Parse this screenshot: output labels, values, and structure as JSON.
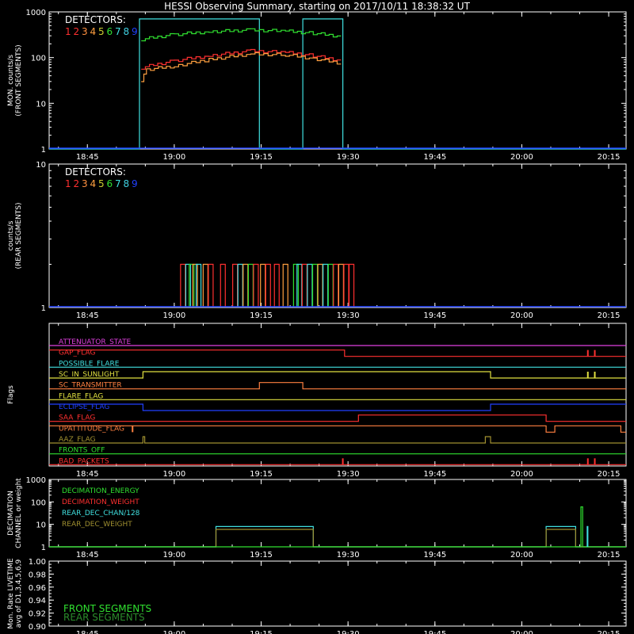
{
  "title": "HESSI Observing Summary, starting on 2017/10/11 18:38:32 UT",
  "colors": {
    "background": "#000000",
    "axis": "#ffffff",
    "det": [
      "#ff3030",
      "#ff3030",
      "#ff9040",
      "#ffa040",
      "#cccc30",
      "#30e030",
      "#40e0e0",
      "#40d0e0",
      "#2040ff"
    ]
  },
  "time_ticks": [
    "18:45",
    "19:00",
    "19:15",
    "19:30",
    "19:45",
    "20:00",
    "20:15"
  ],
  "chart_data": [
    {
      "type": "line",
      "name": "front",
      "ylabel": [
        "MON. counts/s",
        "(FRONT SEGMENTS)"
      ],
      "yscale": "log",
      "ylim": [
        1,
        1000
      ],
      "ytick_labels": [
        "1",
        "10",
        "100",
        "1000"
      ],
      "legend_title": "DETECTORS:",
      "legend_items": [
        "1",
        "2",
        "3",
        "4",
        "5",
        "6",
        "7",
        "8",
        "9"
      ],
      "series": [
        {
          "color": "#40e0e0",
          "values": [
            [
              18.64,
              1
            ],
            [
              18.9,
              1
            ],
            [
              18.9,
              700
            ],
            [
              19.1,
              700
            ],
            [
              19.245,
              700
            ],
            [
              19.245,
              1
            ],
            [
              19.37,
              1
            ],
            [
              19.37,
              700
            ],
            [
              19.485,
              700
            ],
            [
              19.485,
              1
            ],
            [
              20.3,
              1
            ]
          ]
        },
        {
          "color": "#30e030",
          "values": [
            [
              18.905,
              250
            ],
            [
              19.0,
              320
            ],
            [
              19.1,
              370
            ],
            [
              19.22,
              400
            ],
            [
              19.32,
              380
            ],
            [
              19.4,
              340
            ],
            [
              19.48,
              290
            ]
          ]
        },
        {
          "color": "#ff3030",
          "values": [
            [
              18.905,
              60
            ],
            [
              19.0,
              85
            ],
            [
              19.1,
              110
            ],
            [
              19.22,
              140
            ],
            [
              19.32,
              130
            ],
            [
              19.4,
              110
            ],
            [
              19.48,
              85
            ]
          ]
        },
        {
          "color": "#ffa040",
          "values": [
            [
              18.905,
              32
            ],
            [
              18.92,
              55
            ],
            [
              19.0,
              65
            ],
            [
              19.1,
              90
            ],
            [
              19.22,
              120
            ],
            [
              19.32,
              115
            ],
            [
              19.4,
              95
            ],
            [
              19.48,
              75
            ]
          ]
        }
      ]
    },
    {
      "type": "line",
      "name": "rear",
      "ylabel": [
        "counts/s",
        "(REAR SEGMENTS)"
      ],
      "yscale": "log",
      "ylim": [
        1,
        10
      ],
      "ytick_labels": [
        "1",
        "10"
      ],
      "legend_title": "DETECTORS:",
      "legend_items": [
        "1",
        "2",
        "3",
        "4",
        "5",
        "6",
        "7",
        "8",
        "9"
      ],
      "spikes": [
        {
          "x": 19.025,
          "color": "#ff3030"
        },
        {
          "x": 19.04,
          "color": "#40e0e0"
        },
        {
          "x": 19.05,
          "color": "#30e030"
        },
        {
          "x": 19.06,
          "color": "#ffa040"
        },
        {
          "x": 19.07,
          "color": "#40e0e0"
        },
        {
          "x": 19.09,
          "color": "#ffa040"
        },
        {
          "x": 19.105,
          "color": "#ff3030"
        },
        {
          "x": 19.14,
          "color": "#ff3030"
        },
        {
          "x": 19.175,
          "color": "#ff3030"
        },
        {
          "x": 19.19,
          "color": "#40e0e0"
        },
        {
          "x": 19.205,
          "color": "#ffa040"
        },
        {
          "x": 19.22,
          "color": "#30e030"
        },
        {
          "x": 19.235,
          "color": "#ff3030"
        },
        {
          "x": 19.255,
          "color": "#ffa040"
        },
        {
          "x": 19.27,
          "color": "#ff3030"
        },
        {
          "x": 19.295,
          "color": "#ff3030"
        },
        {
          "x": 19.32,
          "color": "#ffa040"
        },
        {
          "x": 19.35,
          "color": "#30e030"
        },
        {
          "x": 19.36,
          "color": "#40e0e0"
        },
        {
          "x": 19.375,
          "color": "#ff3030"
        },
        {
          "x": 19.39,
          "color": "#40e0e0"
        },
        {
          "x": 19.405,
          "color": "#30e030"
        },
        {
          "x": 19.42,
          "color": "#ffa040"
        },
        {
          "x": 19.435,
          "color": "#40e0e0"
        },
        {
          "x": 19.45,
          "color": "#30e030"
        },
        {
          "x": 19.465,
          "color": "#ff3030"
        },
        {
          "x": 19.48,
          "color": "#ffa040"
        },
        {
          "x": 19.495,
          "color": "#ff3030"
        },
        {
          "x": 19.51,
          "color": "#ff3030"
        }
      ],
      "spike_value": 2,
      "baseline_color": "#2040ff"
    },
    {
      "type": "line",
      "name": "flags",
      "ylabel": [
        "Flags"
      ],
      "flags": [
        {
          "label": "ATTENUATOR_STATE",
          "color": "#e040e0",
          "steps": [
            [
              18.64,
              0
            ],
            [
              20.3,
              0
            ]
          ]
        },
        {
          "label": "GAP_FLAG",
          "color": "#ff3030",
          "steps": [
            [
              18.64,
              1
            ],
            [
              19.49,
              1
            ],
            [
              19.49,
              0
            ],
            [
              20.3,
              0
            ]
          ],
          "ticks": [
            20.19,
            20.21
          ]
        },
        {
          "label": "POSSIBLE_FLARE",
          "color": "#40e0e0",
          "steps": [
            [
              18.64,
              0
            ],
            [
              20.3,
              0
            ]
          ]
        },
        {
          "label": "SC_IN_SUNLIGHT",
          "color": "#e0e040",
          "steps": [
            [
              18.64,
              0
            ],
            [
              18.91,
              0
            ],
            [
              18.91,
              1
            ],
            [
              19.91,
              1
            ],
            [
              19.91,
              0
            ],
            [
              20.3,
              0
            ]
          ],
          "ticks": [
            20.19,
            20.21
          ]
        },
        {
          "label": "SC_TRANSMITTER",
          "color": "#ff8040",
          "steps": [
            [
              18.64,
              0
            ],
            [
              19.245,
              0
            ],
            [
              19.245,
              1
            ],
            [
              19.37,
              1
            ],
            [
              19.37,
              0
            ],
            [
              20.3,
              0
            ]
          ]
        },
        {
          "label": "FLARE_FLAG",
          "color": "#e0e040",
          "steps": [
            [
              18.64,
              0
            ],
            [
              20.3,
              0
            ]
          ]
        },
        {
          "label": "ECLIPSE_FLAG",
          "color": "#2040ff",
          "steps": [
            [
              18.64,
              1
            ],
            [
              18.91,
              1
            ],
            [
              18.91,
              0
            ],
            [
              19.91,
              0
            ],
            [
              19.91,
              1
            ],
            [
              20.3,
              1
            ]
          ]
        },
        {
          "label": "SAA_FLAG",
          "color": "#ff3030",
          "steps": [
            [
              18.64,
              0
            ],
            [
              19.53,
              0
            ],
            [
              19.53,
              1
            ],
            [
              20.07,
              1
            ],
            [
              20.07,
              0
            ],
            [
              20.3,
              0
            ]
          ]
        },
        {
          "label": "UPATTITUDE_FLAG",
          "color": "#ff8040",
          "steps": [
            [
              18.64,
              1
            ],
            [
              20.07,
              1
            ],
            [
              20.07,
              0
            ],
            [
              20.095,
              0
            ],
            [
              20.095,
              1
            ],
            [
              20.285,
              1
            ],
            [
              20.285,
              0
            ],
            [
              20.3,
              0
            ]
          ],
          "ticks": [
            18.88
          ]
        },
        {
          "label": "AAZ_FLAG",
          "color": "#a09030",
          "steps": [
            [
              18.64,
              0
            ],
            [
              18.91,
              0
            ],
            [
              18.91,
              1
            ],
            [
              18.915,
              1
            ],
            [
              18.915,
              0
            ],
            [
              19.895,
              0
            ],
            [
              19.895,
              1
            ],
            [
              19.91,
              1
            ],
            [
              19.91,
              0
            ],
            [
              20.3,
              0
            ]
          ]
        },
        {
          "label": "FRONTS_OFF",
          "color": "#30e030",
          "steps": [
            [
              18.64,
              0
            ],
            [
              20.3,
              0
            ]
          ]
        },
        {
          "label": "BAD_PACKETS",
          "color": "#ff3030",
          "steps": [
            [
              18.64,
              0
            ],
            [
              20.3,
              0
            ]
          ],
          "ticks": [
            19.485,
            20.19,
            20.21
          ]
        }
      ]
    },
    {
      "type": "line",
      "name": "decimation",
      "ylabel": [
        "DECIMATION",
        "CHANNEL or weight"
      ],
      "yscale": "log",
      "ylim": [
        1,
        1000
      ],
      "ytick_labels": [
        "1",
        "10",
        "100",
        "1000"
      ],
      "legend_items": [
        {
          "label": "DECIMATION_ENERGY",
          "color": "#30e030"
        },
        {
          "label": "DECIMATION_WEIGHT",
          "color": "#ff3030"
        },
        {
          "label": "REAR_DEC_CHAN/128",
          "color": "#40e0e0"
        },
        {
          "label": "REAR_DEC_WEIGHT",
          "color": "#a09030"
        }
      ],
      "series": [
        {
          "color": "#40e0e0",
          "values": [
            [
              18.64,
              1
            ],
            [
              19.12,
              1
            ],
            [
              19.12,
              8
            ],
            [
              19.4,
              8
            ],
            [
              19.4,
              1
            ],
            [
              20.07,
              1
            ],
            [
              20.07,
              8
            ],
            [
              20.155,
              8
            ],
            [
              20.155,
              1
            ],
            [
              20.3,
              1
            ]
          ]
        },
        {
          "color": "#a09030",
          "values": [
            [
              18.64,
              1
            ],
            [
              19.12,
              1
            ],
            [
              19.12,
              6
            ],
            [
              19.4,
              6
            ],
            [
              19.4,
              1
            ],
            [
              20.07,
              1
            ],
            [
              20.07,
              6
            ],
            [
              20.155,
              6
            ],
            [
              20.155,
              1
            ],
            [
              20.3,
              1
            ]
          ]
        },
        {
          "color": "#30e030",
          "values": [
            [
              18.64,
              1
            ],
            [
              20.17,
              1
            ],
            [
              20.17,
              60
            ],
            [
              20.175,
              60
            ],
            [
              20.175,
              1
            ],
            [
              20.3,
              1
            ]
          ]
        },
        {
          "color": "#40e0e0",
          "values": [
            [
              20.188,
              1
            ],
            [
              20.188,
              8
            ],
            [
              20.19,
              8
            ],
            [
              20.19,
              1
            ]
          ]
        }
      ]
    },
    {
      "type": "line",
      "name": "livetime",
      "ylabel": [
        "Mon. Rate LIVETIME",
        "avg of D1,3,4,5,6,9"
      ],
      "ylim": [
        0.9,
        1.0
      ],
      "ytick_labels": [
        "0.90",
        "0.92",
        "0.94",
        "0.96",
        "0.98",
        "1.00"
      ],
      "legend_items": [
        {
          "label": "FRONT SEGMENTS",
          "color": "#30e030"
        },
        {
          "label": "REAR SEGMENTS",
          "color": "#2c8c2c"
        }
      ]
    }
  ]
}
